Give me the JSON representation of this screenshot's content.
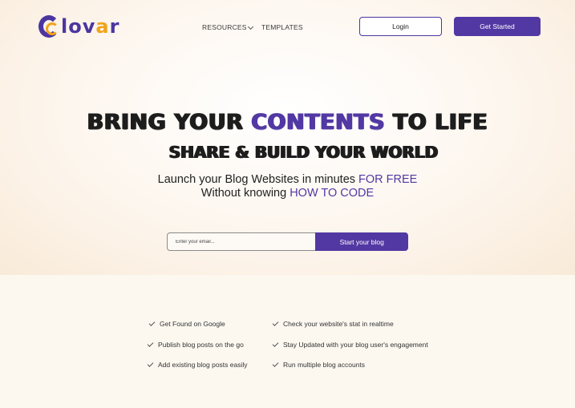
{
  "brand": {
    "name_part1": "lov",
    "name_part2": "a",
    "name_part3": "r",
    "colors": {
      "primary": "#5238a3",
      "accent": "#f0a41c"
    }
  },
  "nav": {
    "resources": "RESOURCES",
    "templates": "TEMPLATES",
    "login": "Login",
    "get_started": "Get Started"
  },
  "hero": {
    "line1_a": "BRING YOUR ",
    "line1_accent": "CONTENTS",
    "line1_b": " TO LIFE",
    "line2": "SHARE & BUILD YOUR WORLD",
    "sub1_a": "Launch your Blog Websites in minutes ",
    "sub1_hl": "FOR FREE",
    "sub2_a": "Without knowing ",
    "sub2_hl": "HOW TO CODE"
  },
  "signup": {
    "email_placeholder": "Enter your email...",
    "email_value": "",
    "submit": "Start your blog"
  },
  "features": {
    "col1": [
      "Get Found on Google",
      "Publish blog posts on the go",
      "Add existing blog posts easily"
    ],
    "col2": [
      "Check your website's stat in realtime",
      "Stay Updated with your blog user's engagement",
      "Run multiple blog accounts"
    ]
  }
}
